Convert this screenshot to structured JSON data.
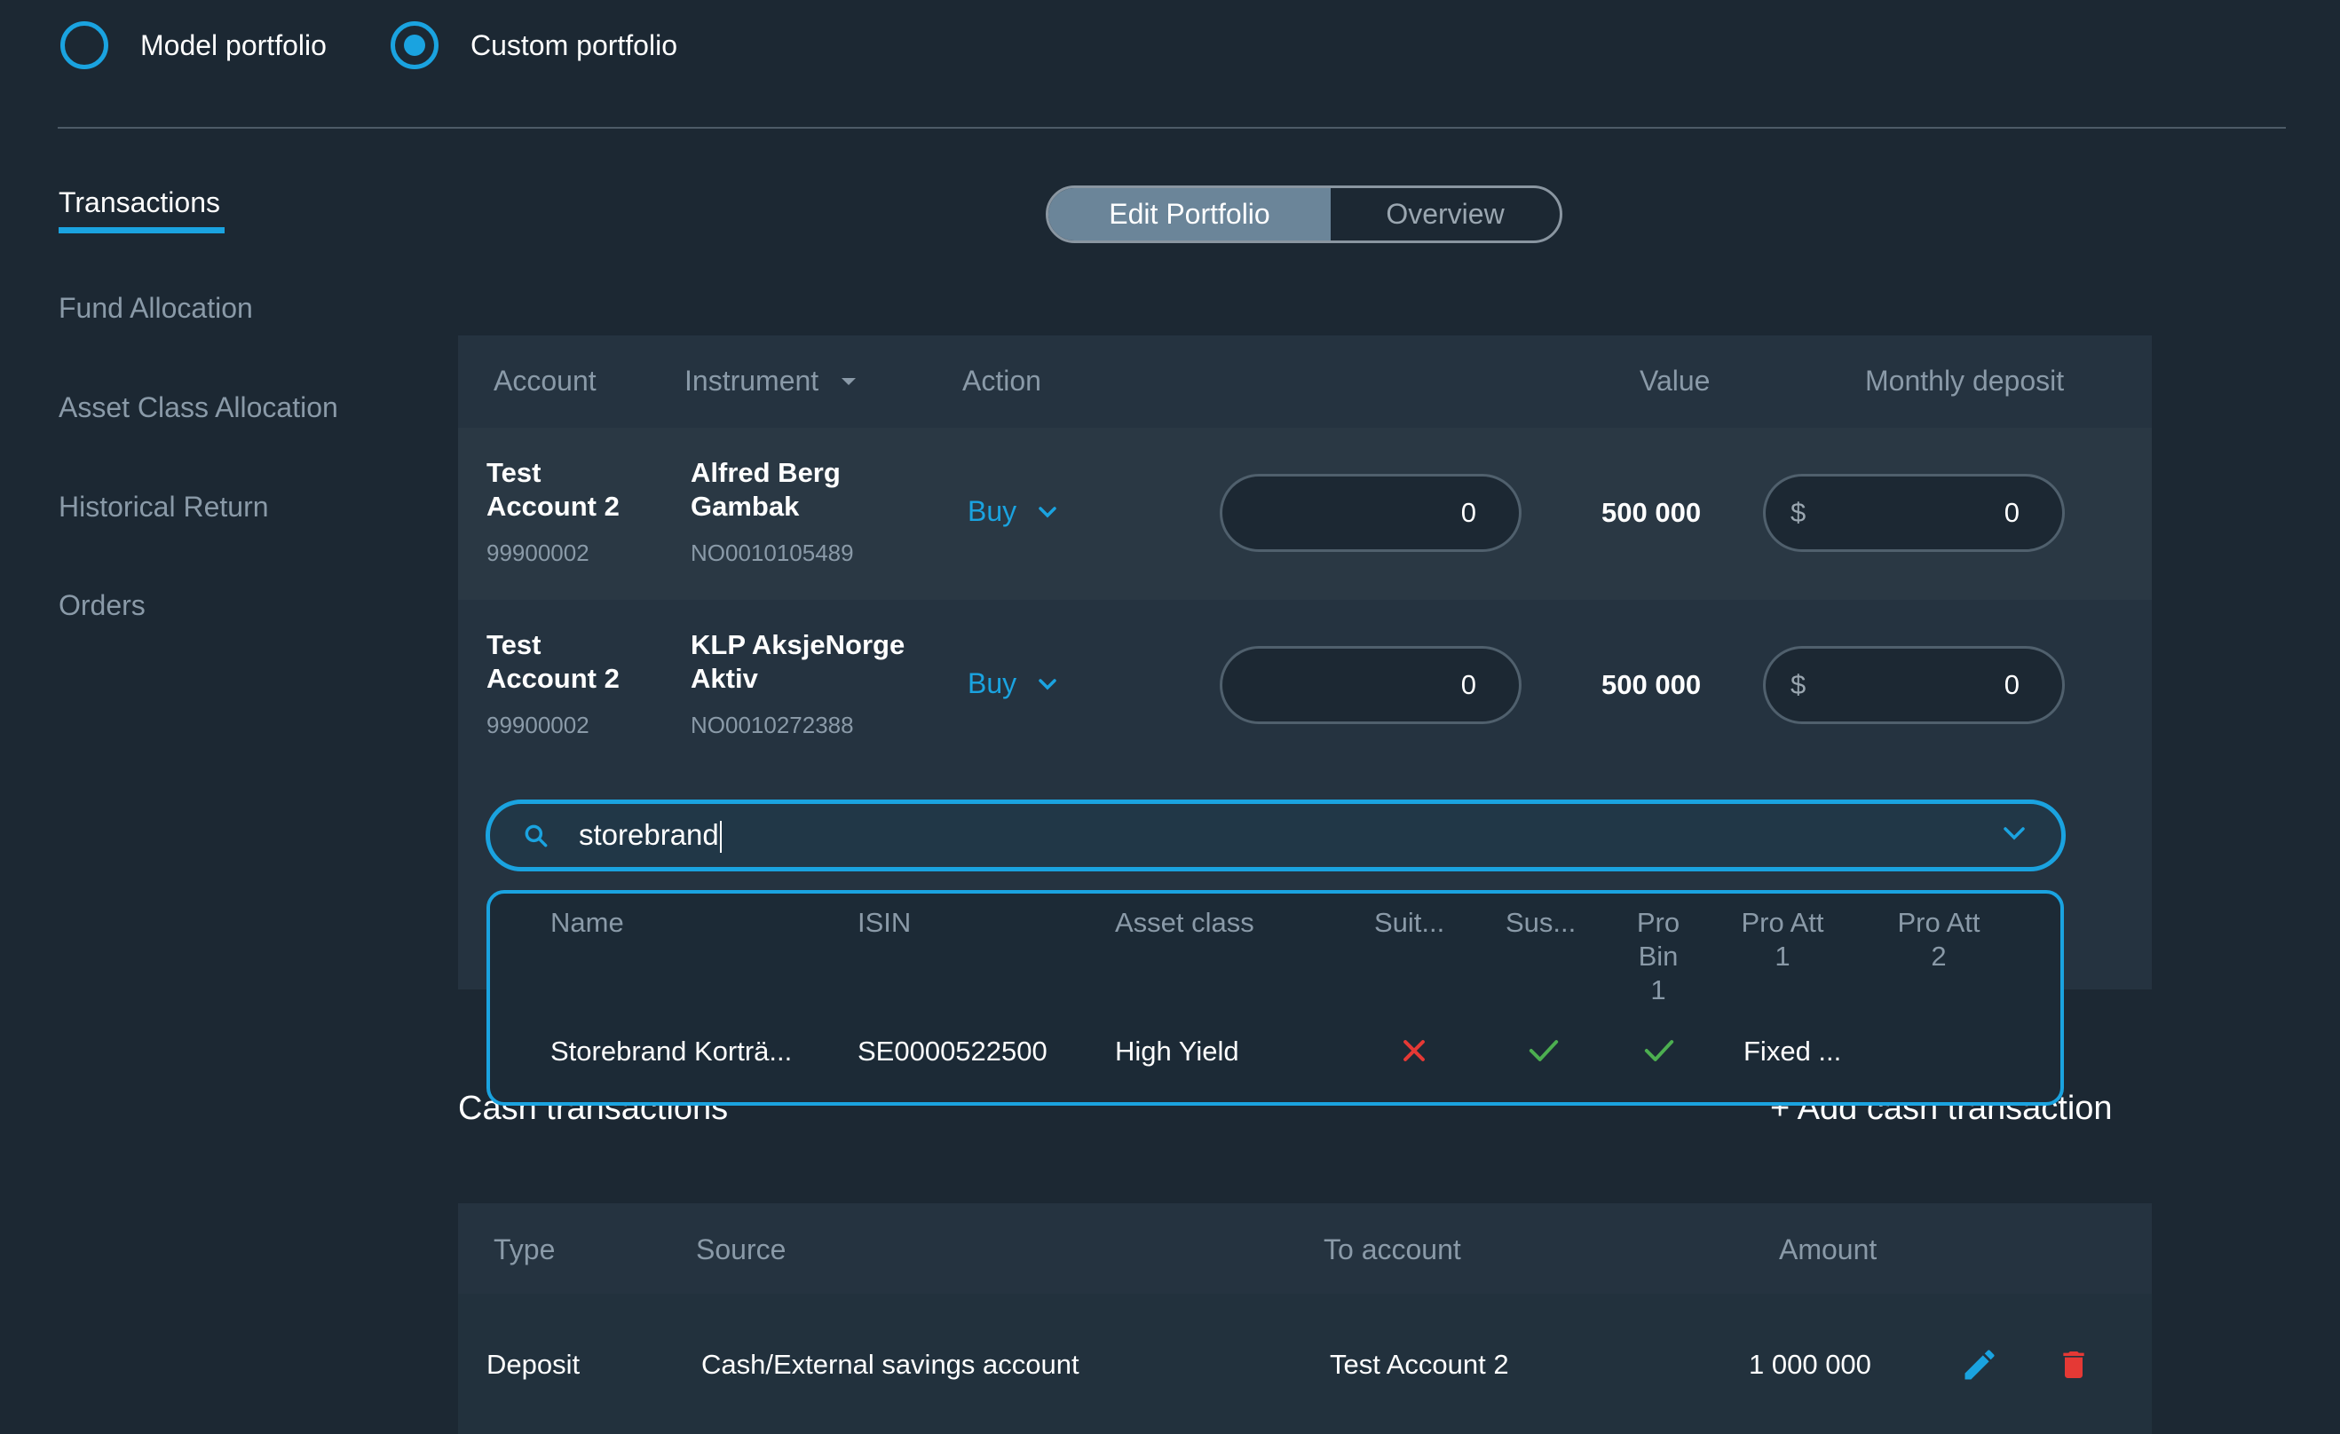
{
  "portfolio_type": {
    "options": [
      {
        "label": "Model portfolio",
        "selected": false
      },
      {
        "label": "Custom portfolio",
        "selected": true
      }
    ]
  },
  "nav": {
    "items": [
      "Transactions",
      "Fund Allocation",
      "Asset Class Allocation",
      "Historical Return",
      "Orders"
    ],
    "active": "Transactions"
  },
  "view_toggle": {
    "options": [
      "Edit Portfolio",
      "Overview"
    ],
    "active": "Edit Portfolio"
  },
  "transactions": {
    "headers": {
      "account": "Account",
      "instrument": "Instrument",
      "action": "Action",
      "value": "Value",
      "monthly_deposit": "Monthly deposit"
    },
    "rows": [
      {
        "account_line1": "Test",
        "account_line2": "Account 2",
        "account_number": "99900002",
        "instrument_line1": "Alfred Berg",
        "instrument_line2": "Gambak",
        "isin": "NO0010105489",
        "action": "Buy",
        "amount": "0",
        "value": "500 000",
        "currency": "$",
        "monthly_deposit": "0"
      },
      {
        "account_line1": "Test",
        "account_line2": "Account 2",
        "account_number": "99900002",
        "instrument_line1": "KLP AksjeNorge",
        "instrument_line2": "Aktiv",
        "isin": "NO0010272388",
        "action": "Buy",
        "amount": "0",
        "value": "500 000",
        "currency": "$",
        "monthly_deposit": "0"
      }
    ]
  },
  "instrument_search": {
    "value": "storebrand",
    "results_headers": {
      "name": "Name",
      "isin": "ISIN",
      "asset_class": "Asset class",
      "suitability": "Suit...",
      "sustainability": "Sus...",
      "pro_bin_1_line1": "Pro",
      "pro_bin_1_line2": "Bin",
      "pro_bin_1_line3": "1",
      "pro_att_1_line1": "Pro Att",
      "pro_att_1_line2": "1",
      "pro_att_2_line1": "Pro Att",
      "pro_att_2_line2": "2"
    },
    "results": [
      {
        "name": "Storebrand Korträ...",
        "isin": "SE0000522500",
        "asset_class": "High Yield",
        "suitability": "cross-icon",
        "sustainability": "check-icon",
        "pro_bin_1": "check-icon",
        "pro_att_1": "Fixed ...",
        "pro_att_2": ""
      }
    ]
  },
  "cash_transactions": {
    "title": "Cash transactions",
    "add_label": "+ Add cash transaction",
    "headers": {
      "type": "Type",
      "source": "Source",
      "to_account": "To account",
      "amount": "Amount"
    },
    "rows": [
      {
        "type": "Deposit",
        "source": "Cash/External savings account",
        "to_account": "Test Account 2",
        "amount": "1 000 000",
        "edit_icon": "pencil-icon",
        "delete_icon": "trash-icon"
      }
    ]
  },
  "colors": {
    "background": "#1c2833",
    "panel": "#253340",
    "accent": "#1aa3e0",
    "muted_text": "#8a9aa8",
    "success": "#4caf50",
    "danger": "#e53935"
  }
}
